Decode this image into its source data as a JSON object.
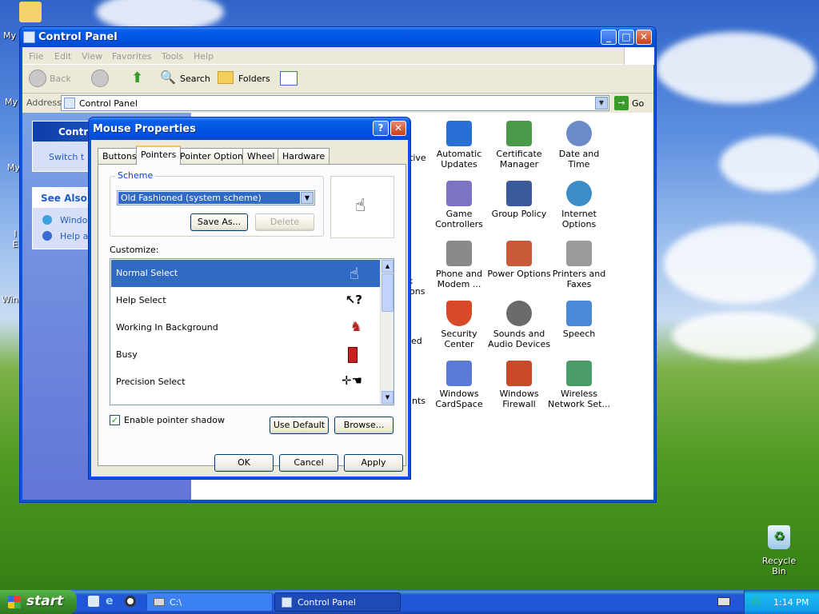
{
  "desktop": {
    "icons": [
      {
        "label": "My I",
        "icon": "my-documents-icon"
      },
      {
        "label": "My",
        "icon": "my-computer-icon"
      },
      {
        "label": "My",
        "icon": "my-network-icon"
      },
      {
        "label": "I E",
        "icon": "internet-explorer-icon"
      },
      {
        "label": "Wind",
        "icon": "windows-icon"
      },
      {
        "label": "Recycle Bin",
        "icon": "recycle-bin-icon"
      }
    ]
  },
  "window": {
    "title": "Control Panel",
    "menu": [
      "File",
      "Edit",
      "View",
      "Favorites",
      "Tools",
      "Help"
    ],
    "toolbar": {
      "back": "Back",
      "search": "Search",
      "folders": "Folders"
    },
    "address": {
      "label": "Address",
      "value": "Control Panel",
      "go": "Go"
    },
    "leftpane": {
      "control_head": "Contro",
      "switch_link": "Switch t",
      "see_also_head": "See Also",
      "see_also_items": [
        "Windov",
        "Help an"
      ]
    },
    "items": [
      {
        "label": "Automatic Updates",
        "icon": "shield-globe-icon",
        "color": "#2a6fd6"
      },
      {
        "label": "Certificate Manager",
        "icon": "certificate-icon",
        "color": "#4a9a4a"
      },
      {
        "label": "Date and Time",
        "icon": "clock-icon",
        "color": "#6a8ac8"
      },
      {
        "label": "Game Controllers",
        "icon": "gamepad-icon",
        "color": "#7c74c0"
      },
      {
        "label": "Group Policy",
        "icon": "users-icon",
        "color": "#3a5a9a"
      },
      {
        "label": "Internet Options",
        "icon": "globe-icon",
        "color": "#3c8cc8"
      },
      {
        "label": "Phone and Modem ...",
        "icon": "phone-icon",
        "color": "#8a8a8a"
      },
      {
        "label": "Power Options",
        "icon": "power-icon",
        "color": "#c85a3a"
      },
      {
        "label": "Printers and Faxes",
        "icon": "printer-icon",
        "color": "#9a9a9a"
      },
      {
        "label": "Security Center",
        "icon": "security-shield-icon",
        "color": "#d64a2a"
      },
      {
        "label": "Sounds and Audio Devices",
        "icon": "speaker-icon",
        "color": "#6a6a6a"
      },
      {
        "label": "Speech",
        "icon": "speech-icon",
        "color": "#4a8ad6"
      },
      {
        "label": "Windows CardSpace",
        "icon": "cardspace-icon",
        "color": "#5a7ad6"
      },
      {
        "label": "Windows Firewall",
        "icon": "firewall-icon",
        "color": "#c84a2a"
      },
      {
        "label": "Wireless Network Set...",
        "icon": "wireless-icon",
        "color": "#4a9a6a"
      }
    ],
    "partial_labels": [
      "tive",
      "k",
      "ons",
      "ed",
      "unts"
    ]
  },
  "dialog": {
    "title": "Mouse Properties",
    "tabs": [
      "Buttons",
      "Pointers",
      "Pointer Options",
      "Wheel",
      "Hardware"
    ],
    "active_tab": "Pointers",
    "scheme_label": "Scheme",
    "scheme_value": "Old Fashioned (system scheme)",
    "save_as": "Save As...",
    "delete": "Delete",
    "customize_label": "Customize:",
    "list": [
      "Normal Select",
      "Help Select",
      "Working In Background",
      "Busy",
      "Precision Select"
    ],
    "shadow_label": "Enable pointer shadow",
    "shadow_checked": true,
    "use_default": "Use Default",
    "browse": "Browse...",
    "ok": "OK",
    "cancel": "Cancel",
    "apply": "Apply"
  },
  "taskbar": {
    "start": "start",
    "items": [
      {
        "label": "C:\\",
        "icon": "drive-icon"
      },
      {
        "label": "Control Panel",
        "icon": "control-panel-icon"
      }
    ],
    "clock": "1:14 PM"
  }
}
